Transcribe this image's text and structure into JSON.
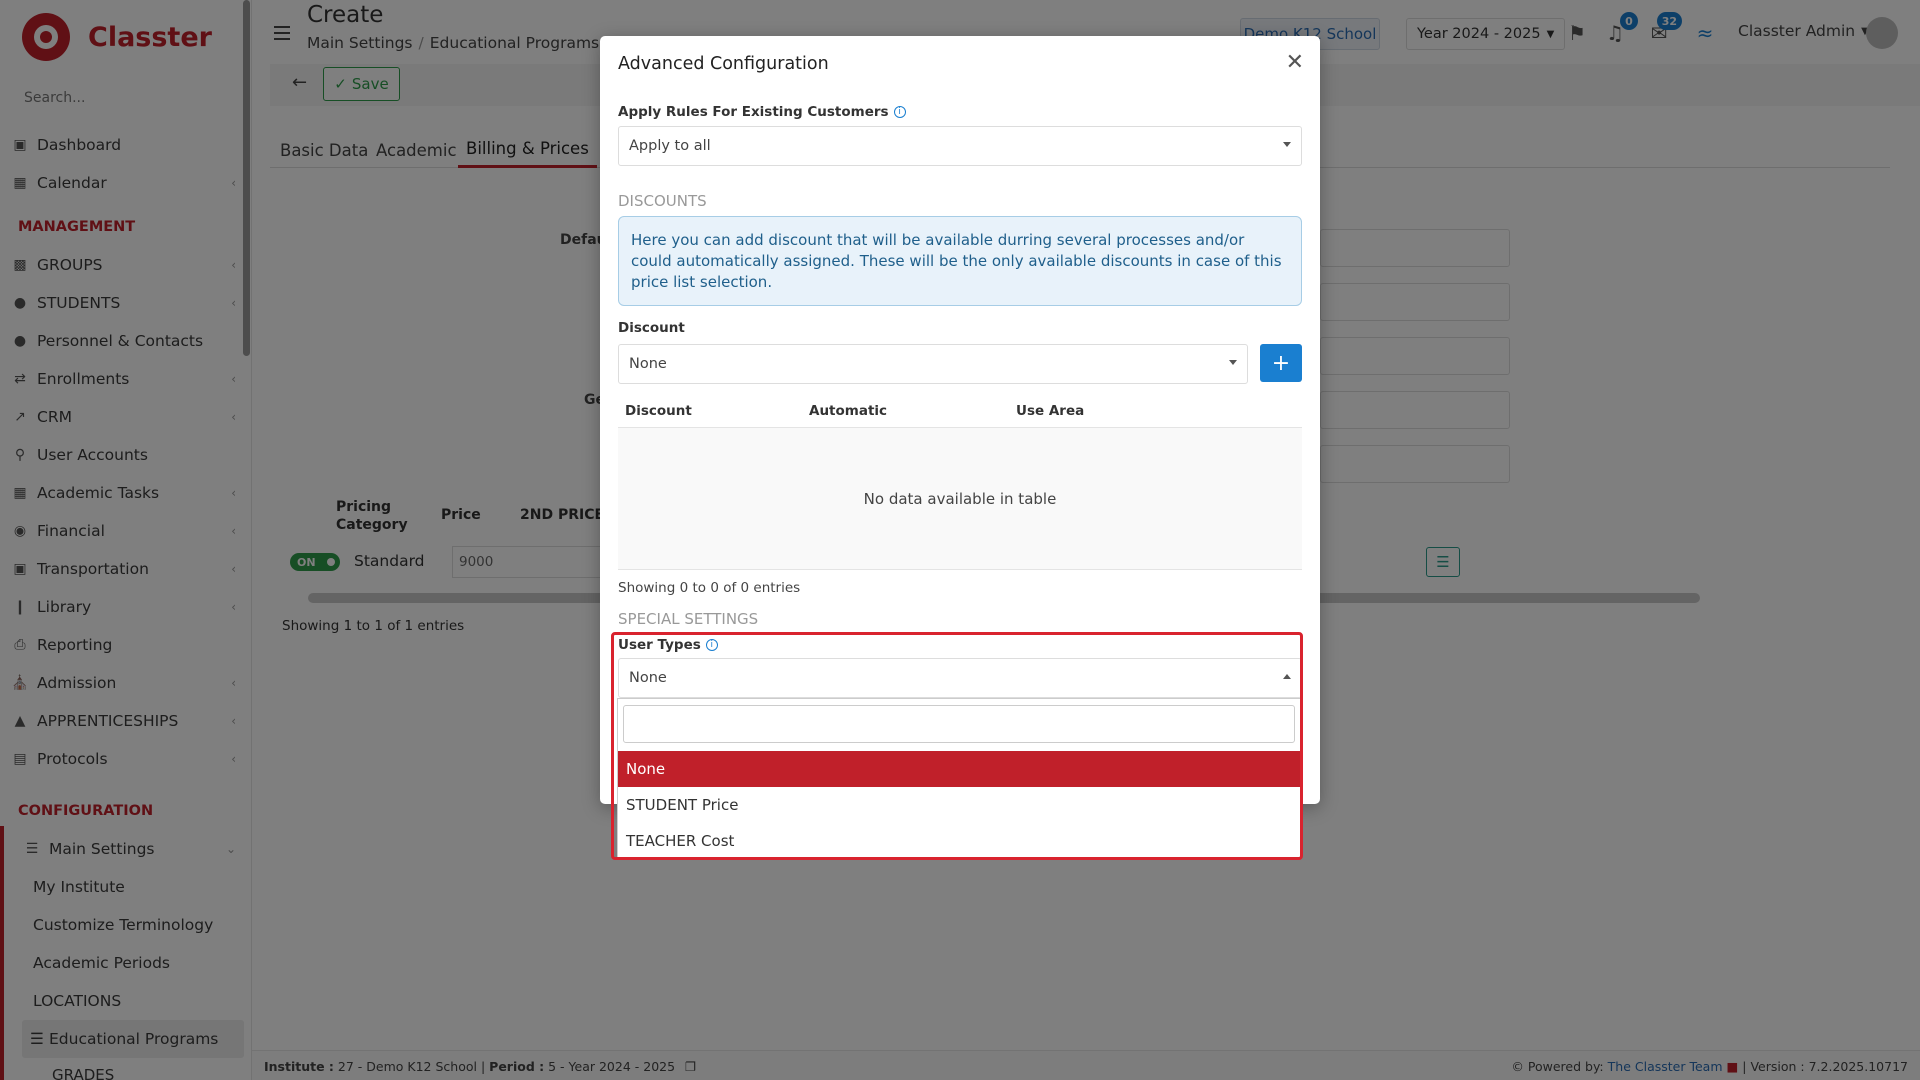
{
  "app": {
    "name": "Classter"
  },
  "sidebar": {
    "search_placeholder": "Search...",
    "items": [
      {
        "label": "Dashboard"
      },
      {
        "label": "Calendar"
      }
    ],
    "management_title": "MANAGEMENT",
    "management": [
      {
        "label": "GROUPS"
      },
      {
        "label": "STUDENTS"
      },
      {
        "label": "Personnel & Contacts"
      },
      {
        "label": "Enrollments"
      },
      {
        "label": "CRM"
      },
      {
        "label": "User Accounts"
      },
      {
        "label": "Academic Tasks"
      },
      {
        "label": "Financial"
      },
      {
        "label": "Transportation"
      },
      {
        "label": "Library"
      },
      {
        "label": "Reporting"
      },
      {
        "label": "Admission"
      },
      {
        "label": "APPRENTICESHIPS"
      },
      {
        "label": "Protocols"
      }
    ],
    "configuration_title": "CONFIGURATION",
    "main_settings": "Main Settings",
    "sub_items": [
      {
        "label": "My Institute"
      },
      {
        "label": "Customize Terminology"
      },
      {
        "label": "Academic Periods"
      },
      {
        "label": "LOCATIONS"
      }
    ],
    "educational_programs": "Educational Programs",
    "grades": "GRADES"
  },
  "header": {
    "title": "Create",
    "breadcrumb": [
      "Main Settings",
      "Educational Programs"
    ],
    "school": "Demo K12 School",
    "year": "Year 2024 - 2025",
    "notifications_count": "0",
    "messages_count": "32",
    "user_name": "Classter Admin"
  },
  "toolbar": {
    "save_label": "Save"
  },
  "tabs": [
    "Basic Data",
    "Academic",
    "Billing & Prices"
  ],
  "background": {
    "default_label": "Defau",
    "ge_label": "Ge",
    "columns": [
      "Pricing Category",
      "Price",
      "2ND PRICE"
    ],
    "row": {
      "toggle": "ON",
      "category": "Standard",
      "price": "9000"
    },
    "entries_info": "Showing 1 to 1 of 1 entries"
  },
  "modal": {
    "title": "Advanced Configuration",
    "apply_rules_label": "Apply Rules For Existing Customers",
    "apply_rules_value": "Apply to all",
    "discounts_title": "DISCOUNTS",
    "discounts_info": "Here you can add discount that will be available durring several processes and/or could automatically assigned. These will be the only available discounts in case of this price list selection.",
    "discount_label": "Discount",
    "discount_value": "None",
    "table_columns": [
      "Discount",
      "Automatic",
      "Use Area"
    ],
    "table_empty": "No data available in table",
    "table_info": "Showing 0 to 0 of 0 entries",
    "special_title": "SPECIAL SETTINGS",
    "user_types_label": "User Types",
    "user_types_value": "None",
    "user_types_options": [
      "None",
      "STUDENT Price",
      "TEACHER Cost"
    ]
  },
  "footer": {
    "institute_label": "Institute :",
    "institute_value": "27 - Demo K12 School",
    "period_label": "Period :",
    "period_value": "5 - Year 2024 - 2025",
    "powered_by": "Powered by:",
    "team": "The Classter Team",
    "version": "| Version : 7.2.2025.10717"
  },
  "colors": {
    "brand": "#c0202a",
    "primary": "#1a7fd0",
    "success": "#2e9c4a"
  }
}
